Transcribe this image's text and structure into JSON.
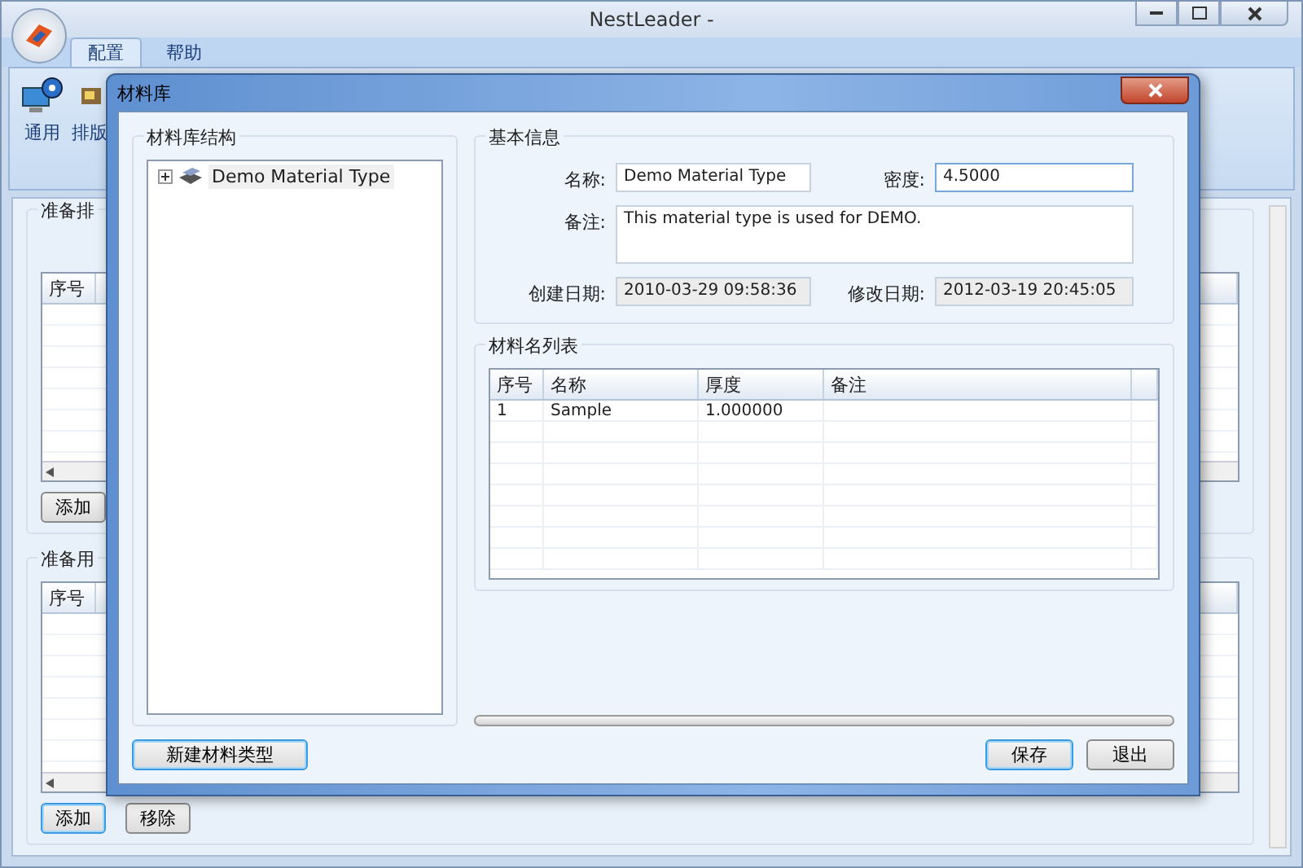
{
  "window": {
    "title": "NestLeader -"
  },
  "ribbon_tabs": [
    {
      "label": "配置",
      "selected": true
    },
    {
      "label": "帮助",
      "selected": false
    }
  ],
  "ribbon_buttons": [
    {
      "label": "通用",
      "kind": "gear"
    },
    {
      "label": "排版",
      "kind": "layout"
    }
  ],
  "panels": [
    {
      "title": "准备排",
      "columns": [
        "序号"
      ],
      "buttons": [
        {
          "label": "添加",
          "focused": false
        }
      ]
    },
    {
      "title": "准备用",
      "columns": [
        "序号"
      ],
      "buttons": [
        {
          "label": "添加",
          "focused": true
        },
        {
          "label": "移除",
          "focused": false
        }
      ]
    }
  ],
  "dialog": {
    "title": "材料库",
    "tree_group": {
      "title": "材料库结构",
      "items": [
        {
          "label": "Demo Material Type",
          "expanded": false
        }
      ]
    },
    "info_group": {
      "title": "基本信息",
      "fields": [
        {
          "label": "名称:",
          "value": "Demo Material Type",
          "kind": "text",
          "focused": false
        },
        {
          "label": "密度:",
          "value": "4.5000",
          "kind": "text",
          "focused": true
        },
        {
          "label": "备注:",
          "value": "This material type is used for DEMO.",
          "kind": "textarea",
          "focused": false
        },
        {
          "label": "创建日期:",
          "value": "2010-03-29 09:58:36",
          "kind": "readonly",
          "focused": false
        },
        {
          "label": "修改日期:",
          "value": "2012-03-19 20:45:05",
          "kind": "readonly",
          "focused": false
        }
      ]
    },
    "list_group": {
      "title": "材料名列表",
      "columns": [
        "序号",
        "名称",
        "厚度",
        "备注"
      ],
      "rows": [
        [
          "1",
          "Sample",
          "1.000000"
        ]
      ]
    },
    "new_button": "新建材料类型",
    "actions": [
      {
        "label": "保存",
        "focused": true
      },
      {
        "label": "退出",
        "focused": false
      }
    ]
  }
}
